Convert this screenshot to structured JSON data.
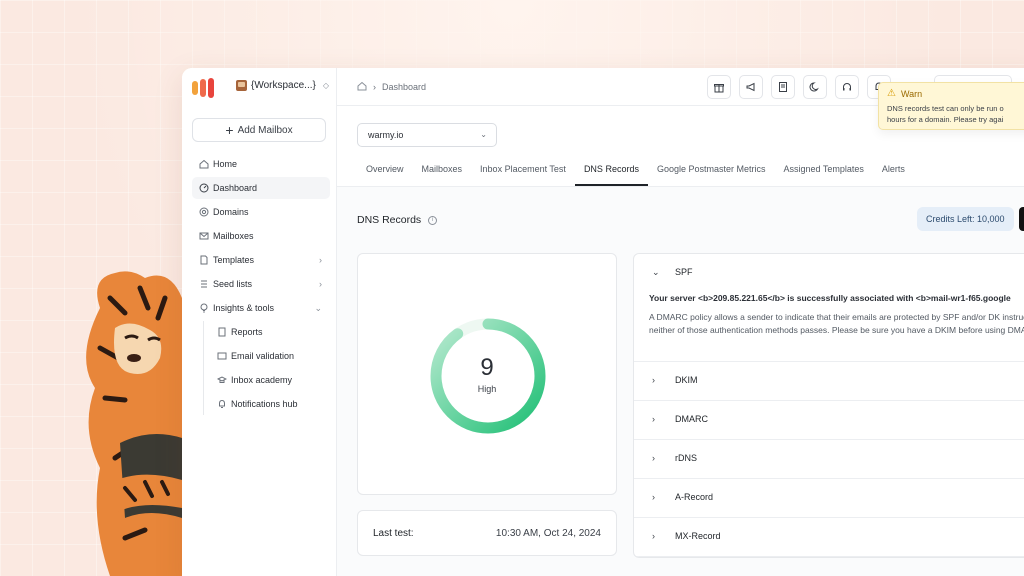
{
  "colors": {
    "brand_bar_1": "#f2a23c",
    "brand_bar_2": "#ef6a4b",
    "brand_bar_3": "#e8443d",
    "gauge_green": "#1fbf75",
    "gauge_track": "#e3f5ec",
    "warn_bg": "#fff7d6",
    "credits_bg": "#e5eef8"
  },
  "sidebar": {
    "workspace_label": "{Workspace...}",
    "add_mailbox_label": "Add Mailbox",
    "items": [
      {
        "label": "Home",
        "icon": "home-icon"
      },
      {
        "label": "Dashboard",
        "icon": "dashboard-icon",
        "active": true
      },
      {
        "label": "Domains",
        "icon": "at-icon"
      },
      {
        "label": "Mailboxes",
        "icon": "mail-icon"
      },
      {
        "label": "Templates",
        "icon": "document-icon"
      },
      {
        "label": "Seed lists",
        "icon": "seed-list-icon"
      },
      {
        "label": "Insights & tools",
        "icon": "lightbulb-icon"
      }
    ],
    "sub_items": [
      {
        "label": "Reports",
        "icon": "report-icon"
      },
      {
        "label": "Email validation",
        "icon": "mail-check-icon"
      },
      {
        "label": "Inbox  academy",
        "icon": "graduation-cap-icon"
      },
      {
        "label": "Notifications hub",
        "icon": "bell-icon"
      }
    ]
  },
  "topbar": {
    "breadcrumb": "Dashboard",
    "icons": [
      "gift-icon",
      "megaphone-icon",
      "book-icon",
      "moon-icon",
      "headset-icon",
      "bell-icon"
    ]
  },
  "warn": {
    "title": "Warn",
    "line1": "DNS records test can only be run o",
    "line2": "hours for a domain. Please try agai"
  },
  "main": {
    "domain_select": "warmy.io",
    "tabs": [
      "Overview",
      "Mailboxes",
      "Inbox Placement Test",
      "DNS Records",
      "Google Postmaster Metrics",
      "Assigned Templates",
      "Alerts"
    ],
    "active_tab": "DNS Records",
    "section_title": "DNS Records",
    "credits_label": "Credits Left: 10,000"
  },
  "score": {
    "value": "9",
    "label": "High",
    "fraction": 0.9
  },
  "last_test": {
    "label": "Last test:",
    "value": "10:30 AM, Oct 24, 2024"
  },
  "records": {
    "expanded": {
      "name": "SPF",
      "status": "Your server <b>209.85.221.65</b> is successfully associated with <b>mail-wr1-f65.google",
      "desc": "A DMARC policy allows a sender to indicate that their emails are protected by SPF and/or DK instruction if neither of those authentication methods passes. Please be sure you have a DKIM before using DMARC"
    },
    "rows": [
      "DKIM",
      "DMARC",
      "rDNS",
      "A-Record",
      "MX-Record"
    ]
  }
}
